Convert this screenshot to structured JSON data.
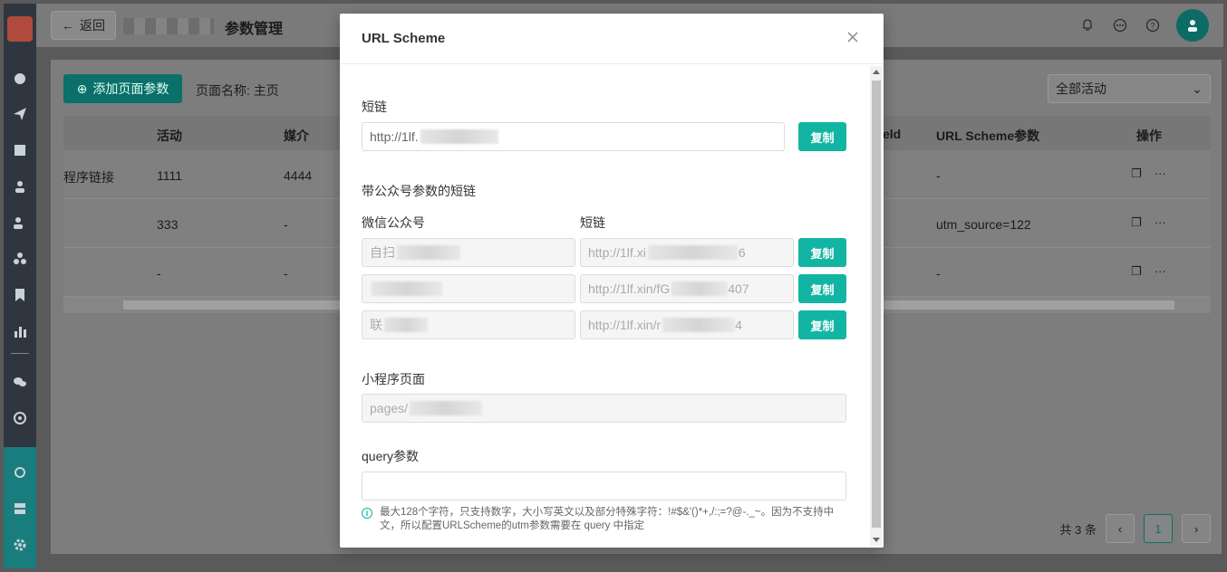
{
  "topbar": {
    "back_label": "返回",
    "page_title": "参数管理"
  },
  "toolbar": {
    "add_button_label": "添加页面参数",
    "page_name": "页面名称: 主页",
    "activity_select_value": "全部活动"
  },
  "table": {
    "headers": [
      "活动",
      "媒介",
      "eld",
      "URL Scheme参数",
      "操作"
    ],
    "rows": [
      {
        "col0": "程序链接",
        "activity": "1111",
        "media": "4444",
        "url_scheme": "-"
      },
      {
        "col0": "",
        "activity": "333",
        "media": "-",
        "url_scheme": "utm_source=122"
      },
      {
        "col0": "",
        "activity": "-",
        "media": "-",
        "url_scheme": "-"
      }
    ]
  },
  "pager": {
    "total": "共 3 条",
    "current_page": "1"
  },
  "modal": {
    "title": "URL Scheme",
    "short_link_label": "短链",
    "short_link_value": "http://1lf.",
    "copy_label": "复制",
    "wechat_section_label": "带公众号参数的短链",
    "wechat_account_col": "微信公众号",
    "short_link_col": "短链",
    "wechat_rows": [
      {
        "account": "自扫",
        "link": "http://1lf.xi",
        "link_tail": "6"
      },
      {
        "account": "",
        "link": "http://1lf.xin/fG",
        "link_tail": "407"
      },
      {
        "account": "联",
        "link": "http://1lf.xin/r",
        "link_tail": "4"
      }
    ],
    "mini_page_label": "小程序页面",
    "mini_page_value": "pages/",
    "query_label": "query参数",
    "query_value": "",
    "hint": "最大128个字符，只支持数字，大小写英文以及部分特殊字符：!#$&'()*+,/:;=?@-._~。因为不支持中文，所以配置URLScheme的utm参数需要在 query 中指定"
  },
  "colors": {
    "accent": "#12b5a3",
    "overlay_sidebar": "#2f3640"
  }
}
